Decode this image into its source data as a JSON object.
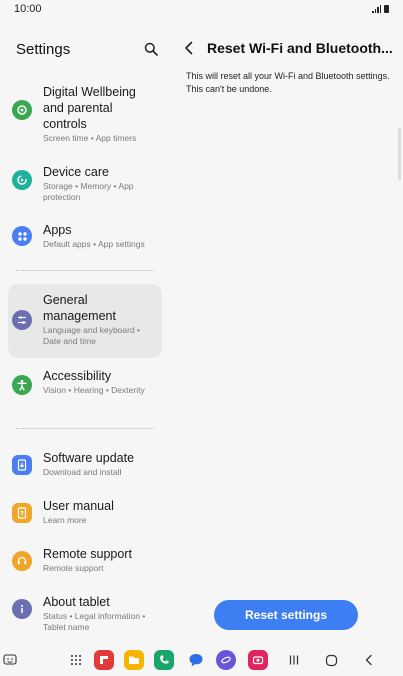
{
  "status_bar": {
    "time": "10:00"
  },
  "left_pane": {
    "title": "Settings",
    "items": [
      {
        "label": "Digital Wellbeing and parental controls",
        "sub": "Screen time  •  App timers",
        "icon": "wellbeing-icon",
        "color": "#3aa852"
      },
      {
        "label": "Device care",
        "sub": "Storage  •  Memory  •  App protection",
        "icon": "device-care-icon",
        "color": "#1fb19a"
      },
      {
        "label": "Apps",
        "sub": "Default apps  •  App settings",
        "icon": "apps-icon",
        "color": "#4b7ef2"
      },
      {
        "label": "General management",
        "sub": "Language and keyboard  •  Date and time",
        "icon": "general-management-icon",
        "color": "#6b6fb1"
      },
      {
        "label": "Accessibility",
        "sub": "Vision  •  Hearing  •  Dexterity",
        "icon": "accessibility-icon",
        "color": "#3aa852"
      },
      {
        "label": "Software update",
        "sub": "Download and install",
        "icon": "software-update-icon",
        "color": "#4b7ef2"
      },
      {
        "label": "User manual",
        "sub": "Learn more",
        "icon": "user-manual-icon",
        "color": "#f0a629"
      },
      {
        "label": "Remote support",
        "sub": "Remote support",
        "icon": "remote-support-icon",
        "color": "#f0a629"
      },
      {
        "label": "About tablet",
        "sub": "Status  •  Legal information  •  Tablet name",
        "icon": "about-tablet-icon",
        "color": "#6b6fb1"
      }
    ]
  },
  "right_pane": {
    "title": "Reset Wi-Fi and Bluetooth...",
    "description": "This will reset all your Wi-Fi and Bluetooth settings. This can't be undone.",
    "button_label": "Reset settings",
    "accent": "#3e7ef3"
  },
  "dock": {
    "apps": [
      "flipboard-icon",
      "my-files-icon",
      "phone-icon",
      "messages-icon",
      "internet-icon",
      "screen-recorder-icon"
    ]
  }
}
